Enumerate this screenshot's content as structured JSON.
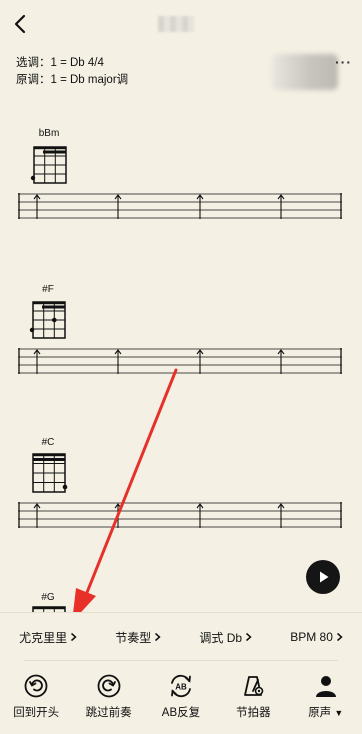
{
  "header": {
    "back_icon": "chevron-left-icon",
    "more_icon": "more-dots-icon"
  },
  "key_info": {
    "selected_key": "选调：1 = Db 4/4",
    "original_key": "原调：1 = Db major调"
  },
  "sheet": {
    "chords": [
      {
        "name": "bBm"
      },
      {
        "name": "#F"
      },
      {
        "name": "#C"
      },
      {
        "name": "#G"
      }
    ]
  },
  "settings": {
    "instrument": "尤克里里",
    "rhythm": "节奏型",
    "key": "调式 Db",
    "bpm": "BPM 80"
  },
  "toolbar": {
    "restart": "回到开头",
    "skip_intro": "跳过前奏",
    "ab_repeat": "AB反复",
    "metronome": "节拍器",
    "original": "原声"
  },
  "colors": {
    "background": "#f4f0e3",
    "annotation_arrow": "#e8302a"
  }
}
